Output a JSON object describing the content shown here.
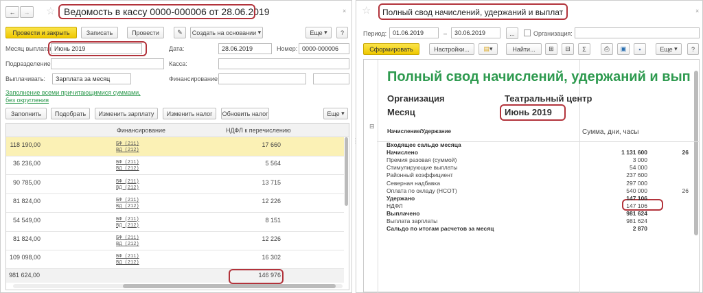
{
  "left": {
    "title": "Ведомость в кассу 0000-000006 от 28.06.2019",
    "toolbar": {
      "post_close": "Провести и закрыть",
      "save": "Записать",
      "post": "Провести",
      "create_based": "Создать на основании",
      "more": "Еще",
      "help": "?"
    },
    "form": {
      "month_label": "Месяц выплаты:",
      "month_value": "Июнь 2019",
      "date_label": "Дата:",
      "date_value": "28.06.2019",
      "number_label": "Номер:",
      "number_value": "0000-000006",
      "dept_label": "Подразделение:",
      "dept_value": "",
      "cash_label": "Касса:",
      "cash_value": "",
      "pay_label": "Выплачивать:",
      "pay_value": "Зарплата за месяц",
      "fin_label": "Финансирование:",
      "fin_value": ""
    },
    "fill_link": "Заполнение всеми причитающимися суммами, без округления",
    "table_toolbar": {
      "fill": "Заполнить",
      "pick": "Подобрать",
      "change_salary": "Изменить зарплату",
      "change_tax": "Изменить налог",
      "update_tax": "Обновить налог",
      "more": "Еще"
    },
    "table": {
      "headers": [
        "",
        "",
        "Финансирование",
        "НДФЛ к перечислению"
      ],
      "rows": [
        {
          "amount": "118 190,00",
          "fin1": "БФ (211)",
          "fin2": "ВД (212)",
          "ndfl": "17 660"
        },
        {
          "amount": "36 236,00",
          "fin1": "БФ (211)",
          "fin2": "ВД (212)",
          "ndfl": "5 564"
        },
        {
          "amount": "90 785,00",
          "fin1": "БФ (211)",
          "fin2": "ВД (212)",
          "ndfl": "13 715"
        },
        {
          "amount": "81 824,00",
          "fin1": "БФ (211)",
          "fin2": "ВД (212)",
          "ndfl": "12 226"
        },
        {
          "amount": "54 549,00",
          "fin1": "БФ (211)",
          "fin2": "ВД (212)",
          "ndfl": "8 151"
        },
        {
          "amount": "81 824,00",
          "fin1": "БФ (211)",
          "fin2": "ВД (212)",
          "ndfl": "12 226"
        },
        {
          "amount": "109 098,00",
          "fin1": "БФ (211)",
          "fin2": "ВД (212)",
          "ndfl": "16 302"
        }
      ],
      "total": {
        "amount": "981 624,00",
        "ndfl": "146 976"
      }
    }
  },
  "right": {
    "title": "Полный свод начислений, удержаний и выплат",
    "period_label": "Период:",
    "period_from": "01.06.2019",
    "period_dash": "–",
    "period_to": "30.06.2019",
    "period_more": "...",
    "org_label": "Организация:",
    "org_value": "",
    "toolbar": {
      "generate": "Сформировать",
      "settings": "Настройки...",
      "find": "Найти...",
      "sum": "Σ",
      "more": "Еще",
      "help": "?"
    },
    "report": {
      "title": "Полный свод начислений, удержаний и выплат",
      "org_label": "Организация",
      "org_value": "Театральный центр",
      "month_label": "Месяц",
      "month_value": "Июнь 2019",
      "col1": "Начисление/Удержание",
      "col2": "Сумма, дни, часы",
      "rows": [
        {
          "name": "Входящее сальдо месяца",
          "value": "",
          "extra": "",
          "bold": true
        },
        {
          "name": "Начислено",
          "value": "1 131 600",
          "extra": "26",
          "bold": true
        },
        {
          "name": "Премия разовая (суммой)",
          "value": "3 000",
          "extra": ""
        },
        {
          "name": "Стимулирующие выплаты",
          "value": "54 000",
          "extra": ""
        },
        {
          "name": "Районный коэффициент",
          "value": "237 600",
          "extra": ""
        },
        {
          "name": "Северная надбавка",
          "value": "297 000",
          "extra": ""
        },
        {
          "name": "Оплата по окладу (НСОТ)",
          "value": "540 000",
          "extra": "26"
        },
        {
          "name": "Удержано",
          "value": "147 106",
          "extra": "",
          "bold": true
        },
        {
          "name": "НДФЛ",
          "value": "147 106",
          "extra": ""
        },
        {
          "name": "Выплачено",
          "value": "981 624",
          "extra": "",
          "bold": true
        },
        {
          "name": "Выплата зарплаты",
          "value": "981 624",
          "extra": ""
        },
        {
          "name": "Сальдо по итогам расчетов за месяц",
          "value": "2 870",
          "extra": "",
          "bold": true
        }
      ]
    }
  },
  "colors": {
    "accent_yellow": "#f5d21e",
    "link_green": "#2e9a4f",
    "highlight": "#b2333b",
    "report_title": "#2e9a4f"
  }
}
